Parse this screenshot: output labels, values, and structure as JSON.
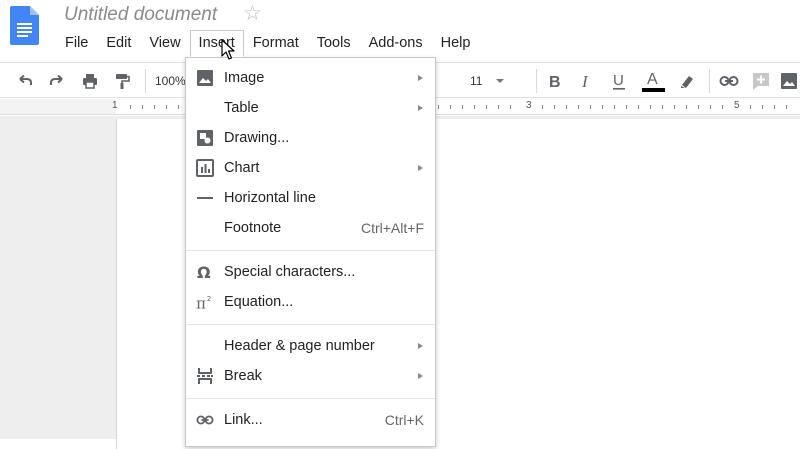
{
  "doc": {
    "title": "Untitled document",
    "star": "☆"
  },
  "menubar": [
    "File",
    "Edit",
    "View",
    "Insert",
    "Format",
    "Tools",
    "Add-ons",
    "Help"
  ],
  "toolbar": {
    "zoom": "100%",
    "font_size": "11",
    "text_color_letter": "A",
    "text_color": "#000000"
  },
  "ruler": {
    "numbers": [
      "1",
      "3",
      "5"
    ]
  },
  "insert_menu": {
    "groups": [
      [
        {
          "label": "Image",
          "icon": "image-icon",
          "submenu": true,
          "shortcut": ""
        },
        {
          "label": "Table",
          "icon": "",
          "submenu": true,
          "shortcut": ""
        },
        {
          "label": "Drawing...",
          "icon": "drawing-icon",
          "submenu": false,
          "shortcut": ""
        },
        {
          "label": "Chart",
          "icon": "chart-icon",
          "submenu": true,
          "shortcut": ""
        },
        {
          "label": "Horizontal line",
          "icon": "horizontal-line-icon",
          "submenu": false,
          "shortcut": ""
        },
        {
          "label": "Footnote",
          "icon": "",
          "submenu": false,
          "shortcut": "Ctrl+Alt+F"
        }
      ],
      [
        {
          "label": "Special characters...",
          "icon": "omega-icon",
          "submenu": false,
          "shortcut": ""
        },
        {
          "label": "Equation...",
          "icon": "pi-icon",
          "submenu": false,
          "shortcut": ""
        }
      ],
      [
        {
          "label": "Header & page number",
          "icon": "",
          "submenu": true,
          "shortcut": ""
        },
        {
          "label": "Break",
          "icon": "break-icon",
          "submenu": true,
          "shortcut": ""
        }
      ],
      [
        {
          "label": "Link...",
          "icon": "link-icon",
          "submenu": false,
          "shortcut": "Ctrl+K"
        }
      ]
    ]
  },
  "colors": {
    "docs_blue": "#4285f4",
    "icon_gray": "#5f6368",
    "accent_blue": "#1a73e8"
  }
}
